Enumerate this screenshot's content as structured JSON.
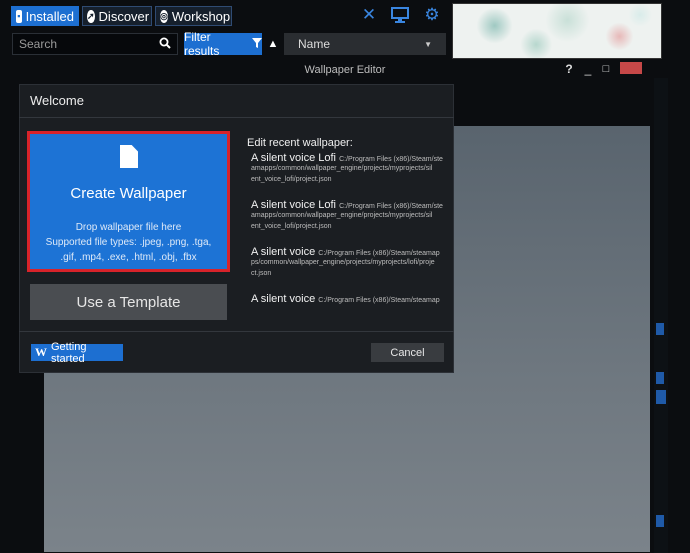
{
  "tabs": [
    {
      "label": "Installed",
      "icon": "save-icon"
    },
    {
      "label": "Discover",
      "icon": "compass-icon"
    },
    {
      "label": "Workshop",
      "icon": "steam-icon"
    }
  ],
  "toolbar_icons": [
    "tools-icon",
    "monitor-icon",
    "gear-icon"
  ],
  "search": {
    "placeholder": "Search",
    "icon": "search-icon"
  },
  "filter": {
    "label": "Filter results",
    "icon": "funnel-icon"
  },
  "sort": {
    "direction_icon": "triangle-up-icon",
    "selected": "Name"
  },
  "editor": {
    "title": "Wallpaper Editor",
    "help": "?",
    "minimize": "_",
    "maximize": "□"
  },
  "dialog": {
    "title": "Welcome",
    "create": {
      "title": "Create Wallpaper",
      "drop_text": "Drop wallpaper file here",
      "types_line1": "Supported file types: .jpeg, .png, .tga,",
      "types_line2": ".gif, .mp4, .exe, .html, .obj, .fbx"
    },
    "template_label": "Use a Template",
    "recent_heading": "Edit recent wallpaper:",
    "recent": [
      {
        "name": "A silent voice Lofi",
        "path_inline": "C:/Program Files (x86)/Steam/ste",
        "path_lines": [
          "amapps/common/wallpaper_engine/projects/myprojects/sil",
          "ent_voice_lofi/project.json"
        ]
      },
      {
        "name": "A silent voice Lofi",
        "path_inline": "C:/Program Files (x86)/Steam/ste",
        "path_lines": [
          "amapps/common/wallpaper_engine/projects/myprojects/sil",
          "ent_voice_lofi/project.json"
        ]
      },
      {
        "name": "A silent voice",
        "path_inline": "C:/Program Files (x86)/Steam/steamap",
        "path_lines": [
          "ps/common/wallpaper_engine/projects/myprojects/lofi/proje",
          "ct.json"
        ]
      },
      {
        "name": "A silent voice",
        "path_inline": "C:/Program Files (x86)/Steam/steamap",
        "path_lines": []
      }
    ],
    "getting_started": {
      "label": "Getting started",
      "icon": "wikipedia-w-icon"
    },
    "cancel_label": "Cancel"
  },
  "colors": {
    "accent": "#1d6fd1",
    "highlight": "#d8232a",
    "dialog_bg": "#1b1e22"
  }
}
